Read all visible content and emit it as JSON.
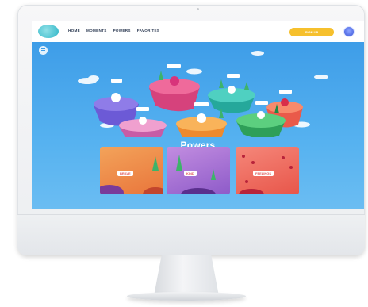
{
  "nav": {
    "items": [
      "HOME",
      "MOMENTS",
      "POWERS",
      "FAVORITES"
    ]
  },
  "header": {
    "cta_label": "SIGN UP"
  },
  "hero": {
    "title": "Powers"
  },
  "cards": [
    {
      "label": "BRAVE"
    },
    {
      "label": "KIND"
    },
    {
      "label": "FEELINGS"
    }
  ],
  "icons": {
    "logo": "brand-logo",
    "menu": "menu-icon",
    "account": "avatar-icon"
  },
  "colors": {
    "sky": "#4aa3e8",
    "cta": "#f6c02d",
    "card_orange": "#e9753b",
    "card_purple": "#8e5bc9",
    "card_red": "#e8564a"
  }
}
